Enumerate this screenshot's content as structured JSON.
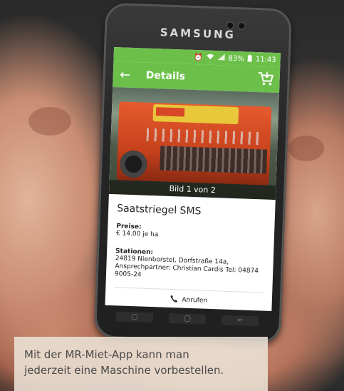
{
  "device": {
    "brand": "SAMSUNG"
  },
  "statusbar": {
    "battery": "83%",
    "time": "11:43"
  },
  "toolbar": {
    "title": "Details"
  },
  "image": {
    "caption": "Bild 1 von 2"
  },
  "machine": {
    "name": "Saatstriegel SMS",
    "prices_label": "Preise:",
    "prices_value": "€ 14.00 je ha",
    "stations_label": "Stationen:",
    "stations_value": "24819 Nienborstel, Dorfstraße 14a, Ansprechpartner: Christian Cardis Tel: 04874 9005-24"
  },
  "actions": {
    "call_label": "Anrufen"
  },
  "caption_box": {
    "line1": "Mit der MR-Miet-App kann man",
    "line2": "jederzeit eine Maschine vorbestellen."
  },
  "colors": {
    "app_green": "#6cc04a",
    "machine_orange": "#e65a2e"
  },
  "icons": [
    "back-arrow-icon",
    "cart-icon",
    "phone-icon",
    "wifi-icon",
    "signal-icon",
    "battery-icon",
    "alarm-icon"
  ]
}
